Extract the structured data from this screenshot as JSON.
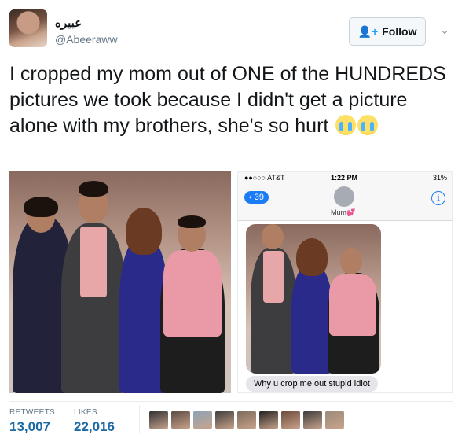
{
  "author": {
    "display_name": "عبيره",
    "handle": "@Abeeraww"
  },
  "follow": {
    "label": "Follow",
    "icon": "add-user-icon"
  },
  "more_icon": "chevron-down-icon",
  "tweet": {
    "text": "I cropped my mom out of ONE of the HUNDREDS pictures we took because I didn't get a picture alone with my brothers, she's so hurt",
    "emoji": [
      "loudly-crying-face",
      "loudly-crying-face"
    ]
  },
  "phone": {
    "carrier": "●●○○○ AT&T",
    "time": "1:22 PM",
    "battery": "31%",
    "back_count": "39",
    "contact_name": "Mum💕",
    "message": "Why u crop me out stupid idiot"
  },
  "stats": {
    "retweets_label": "RETWEETS",
    "retweets_value": "13,007",
    "likes_label": "LIKES",
    "likes_value": "22,016"
  },
  "likers": [
    "#2b2f33",
    "#5a4a42",
    "#8ca3b8",
    "#3c3c3c",
    "#7a6a5a",
    "#1f1f1f",
    "#6b4a3a",
    "#3a3a3a",
    "#9a8a7a"
  ],
  "colors": {
    "accent": "#1da1f2",
    "stat_value": "#1c6aa3",
    "bubble": "#e5e5ea"
  }
}
